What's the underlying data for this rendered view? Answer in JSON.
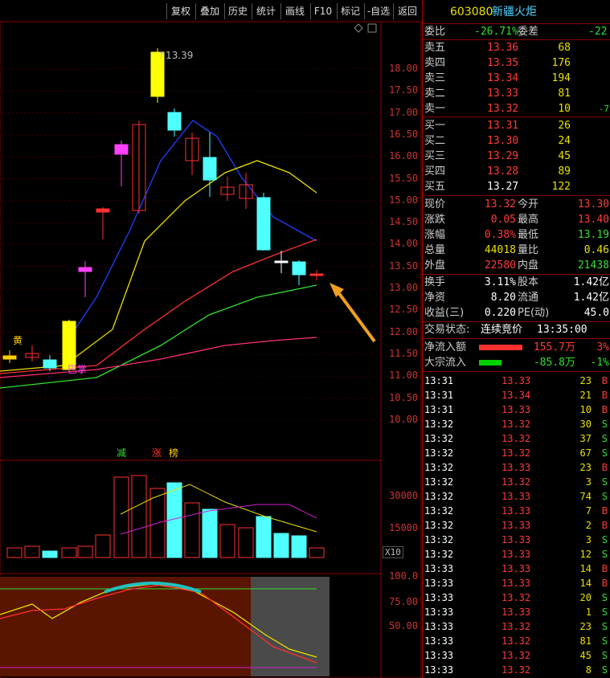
{
  "toolbar": [
    "复权",
    "叠加",
    "历史",
    "统计",
    "画线",
    "F10",
    "标记",
    "-自选",
    "返回"
  ],
  "chart_data": {
    "type": "candlestick",
    "price_axis": {
      "ticks": [
        "18.00",
        "17.50",
        "17.00",
        "16.50",
        "16.00",
        "15.50",
        "15.00",
        "14.50",
        "14.00",
        "13.50",
        "13.00",
        "12.50",
        "12.00",
        "11.50",
        "11.00",
        "10.50",
        "10.00"
      ]
    },
    "volume_axis": {
      "ticks": [
        "30000",
        "15000"
      ],
      "unit": "X10"
    },
    "kdj_axis": {
      "ticks": [
        "100.0",
        "75.00",
        "50.00"
      ]
    },
    "max_price_label": "13.39",
    "annotations": [
      "黄",
      "巴掌",
      "减",
      "涨",
      "榜"
    ]
  },
  "stock": {
    "code": "603080",
    "name": "新疆火炬"
  },
  "order": {
    "weibi_label": "委比",
    "weibi_value": "-26.71%",
    "weicha_label": "委差",
    "weicha_value": "-22",
    "sell": [
      {
        "label": "卖五",
        "price": "13.36",
        "vol": "68",
        "chg": ""
      },
      {
        "label": "卖四",
        "price": "13.35",
        "vol": "176",
        "chg": ""
      },
      {
        "label": "卖三",
        "price": "13.34",
        "vol": "194",
        "chg": ""
      },
      {
        "label": "卖二",
        "price": "13.33",
        "vol": "81",
        "chg": ""
      },
      {
        "label": "卖一",
        "price": "13.32",
        "vol": "10",
        "chg": "-7"
      }
    ],
    "buy": [
      {
        "label": "买一",
        "price": "13.31",
        "vol": "26"
      },
      {
        "label": "买二",
        "price": "13.30",
        "vol": "24"
      },
      {
        "label": "买三",
        "price": "13.29",
        "vol": "45"
      },
      {
        "label": "买四",
        "price": "13.28",
        "vol": "89"
      },
      {
        "label": "买五",
        "price": "13.27",
        "vol": "122"
      }
    ]
  },
  "quote": [
    {
      "l1": "现价",
      "v1": "13.32",
      "l2": "今开",
      "v2": "13.30",
      "c1": "red",
      "c2": "red"
    },
    {
      "l1": "涨跌",
      "v1": "0.05",
      "l2": "最高",
      "v2": "13.40",
      "c1": "red",
      "c2": "red"
    },
    {
      "l1": "涨幅",
      "v1": "0.38%",
      "l2": "最低",
      "v2": "13.19",
      "c1": "red",
      "c2": "green"
    },
    {
      "l1": "总量",
      "v1": "44018",
      "l2": "量比",
      "v2": "0.46",
      "c1": "yel",
      "c2": "yel"
    },
    {
      "l1": "外盘",
      "v1": "22580",
      "l2": "内盘",
      "v2": "21438",
      "c1": "red",
      "c2": "green"
    },
    {
      "l1": "换手",
      "v1": "3.11%",
      "l2": "股本",
      "v2": "1.42亿",
      "c1": "wht",
      "c2": "wht"
    },
    {
      "l1": "净资",
      "v1": "8.20",
      "l2": "流通",
      "v2": "1.42亿",
      "c1": "wht",
      "c2": "wht"
    },
    {
      "l1": "收益(三)",
      "v1": "0.220",
      "l2": "PE(动)",
      "v2": "45.0",
      "c1": "wht",
      "c2": "wht"
    }
  ],
  "status": {
    "label": "交易状态:",
    "value": "连续竞价",
    "time": "13:35:00"
  },
  "flow": [
    {
      "label": "净流入额",
      "value": "155.7万",
      "pct": "3%",
      "color": "#ff3030",
      "vcolor": "red"
    },
    {
      "label": "大宗流入",
      "value": "-85.8万",
      "pct": "-1%",
      "color": "#00d000",
      "vcolor": "green"
    }
  ],
  "ticks": [
    [
      "13:31",
      "13.33",
      "23",
      "B"
    ],
    [
      "13:31",
      "13.34",
      "21",
      "B"
    ],
    [
      "13:31",
      "13.33",
      "10",
      "B"
    ],
    [
      "13:32",
      "13.32",
      "30",
      "S"
    ],
    [
      "13:32",
      "13.32",
      "37",
      "S"
    ],
    [
      "13:32",
      "13.32",
      "67",
      "S"
    ],
    [
      "13:32",
      "13.33",
      "23",
      "B"
    ],
    [
      "13:32",
      "13.32",
      "3",
      "S"
    ],
    [
      "13:32",
      "13.33",
      "74",
      "S"
    ],
    [
      "13:32",
      "13.33",
      "7",
      "B"
    ],
    [
      "13:32",
      "13.33",
      "2",
      "B"
    ],
    [
      "13:32",
      "13.33",
      "3",
      "S"
    ],
    [
      "13:32",
      "13.33",
      "12",
      "S"
    ],
    [
      "13:33",
      "13.33",
      "14",
      "B"
    ],
    [
      "13:33",
      "13.33",
      "14",
      "B"
    ],
    [
      "13:33",
      "13.32",
      "20",
      "S"
    ],
    [
      "13:33",
      "13.33",
      "1",
      "S"
    ],
    [
      "13:33",
      "13.32",
      "23",
      "S"
    ],
    [
      "13:33",
      "13.32",
      "81",
      "S"
    ],
    [
      "13:33",
      "13.32",
      "45",
      "S"
    ],
    [
      "13:33",
      "13.32",
      "8",
      "S"
    ]
  ]
}
